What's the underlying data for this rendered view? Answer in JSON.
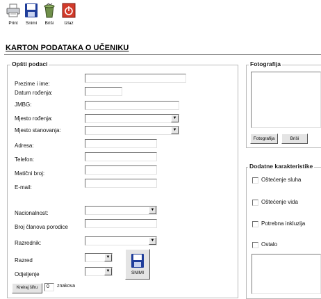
{
  "toolbar": {
    "print_label": "Print",
    "save_label": "Snimi",
    "delete_label": "Briši",
    "exit_label": "Izlaz"
  },
  "page_title": "KARTON PODATAKA O UČENIKU",
  "general": {
    "legend": "Opšti podaci",
    "fields": {
      "name": "Prezime i ime:",
      "dob": "Datum rođenja:",
      "jmbg": "JMBG:",
      "pob": "Mjesto rođenja:",
      "residence": "Mjesto stanovanja:",
      "address": "Adresa:",
      "phone": "Telefon:",
      "reg_no": "Matični broj:",
      "email": "E-mail:",
      "nationality": "Nacionalnost:",
      "family": "Broj članova porodice",
      "teacher": "Razrednik:",
      "grade": "Razred",
      "section": "Odjeljenje"
    },
    "save_button": "SNIMI",
    "bottom_button": "Kreiraj šifru",
    "counter_value": "0",
    "counter_suffix": "znakova"
  },
  "photo": {
    "legend": "Fotografija",
    "photo_button": "Fotografija",
    "delete_button": "Briši"
  },
  "extra": {
    "legend": "Dodatne karakteristike",
    "options": {
      "hearing": "Oštećenje sluha",
      "vision": "Oštećenje vida",
      "inclusion": "Potrebna inkluzija",
      "other": "Ostalo"
    }
  }
}
